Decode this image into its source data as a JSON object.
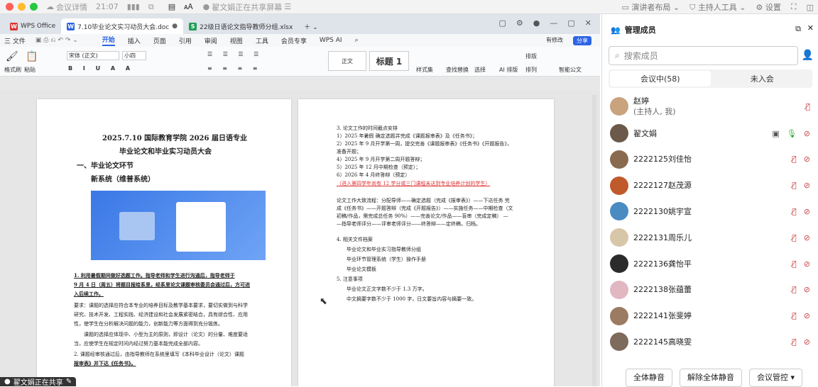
{
  "topbar": {
    "meeting_details": "会议详情",
    "time": "21:07",
    "sharing": "翟文娟正在共享屏幕",
    "presenter_layout": "演讲者布局",
    "host_tools": "主持人工具",
    "settings": "设置"
  },
  "wps": {
    "tabs": [
      "WPS Office",
      "7.10毕业论文实习动员大会.doc",
      "22级日语论文指导教师分组.xlsx"
    ],
    "menus": [
      "三 文件",
      "开始",
      "插入",
      "页面",
      "引用",
      "审阅",
      "视图",
      "工具",
      "会员专享",
      "WPS AI"
    ],
    "edit_label": "有修改",
    "share_label": "分享",
    "ribbon": {
      "format_painter": "格式刷",
      "paste": "粘贴",
      "font": "宋体 (正文)",
      "size": "小四",
      "style_normal": "正文",
      "style_heading": "标题 1",
      "style_set": "样式集",
      "find_replace": "查找替换",
      "select": "选择",
      "ai_layout": "AI 排版",
      "arrange": "排版",
      "sort": "排列",
      "smart_doc": "智能公文"
    }
  },
  "page1": {
    "title1": "2025.7.10 国际教育学院 2026 届日语专业",
    "title2": "毕业论文和毕业实习动员大会",
    "h1": "一、毕业论文环节",
    "h2": "新系统（维普系统）",
    "l1": "1. 利用暑假期间做好选题工作。指导老师和学生进行沟通后，指导老师于",
    "l2": "9 月 4 日（周五）将题目报给系里，经系里论文课题审核委员会通过后，方可进",
    "l3": "入后续工作。",
    "l4": "要求：课题的选择应符合本专业的培养目标及教学基本要求，要切实做到与科学",
    "l5": "研究、技术开发、工程实践、经济建设和社会发展紧密结合，具有综合性、应用",
    "l6": "性，使学生在分析解决问题的能力，创新能力等方面得到充分锻炼。",
    "l7": "课题的选择应体现中、小型为主的原则，即设计（论文）的分量、难度要适",
    "l8": "当，应使学生在规定时间内经过努力基本能完成全部内容。",
    "l9": "2. 课题经审核通过后，由指导教师在系统里填写《本科毕业设计（论文）课题",
    "l10": "报审表》并下达《任务书》。"
  },
  "page2": {
    "p1": "3. 论文工作的时间截点安排",
    "p2": "1）2025 年暑假 确定选题并完成《课题报审表》及《任务书》；",
    "p3": "2）2025 年 9 月开学第一周，提交完善《课题报审表》《任务书》《开题报告》，",
    "p4": "准备开题；",
    "p5": "4）2025 年 9 月开学第二周开题答辩；",
    "p6": "5）2025 年 12 月中期检查（预定）；",
    "p7": "6）2026 年 4 月终答辩（预定）",
    "p8": "（进入第四学年尚有 12 学分或三门课程未达到专业培养计划的学生）",
    "p9": "论文工作大致流程：分配导师——确定选题（完成《报审表》）——下达任务 完",
    "p10": "成《任务书》——开题答辩（完成《开题报告》）——实施任务——中期检查（文",
    "p11": "初稿/作品，需完成总任务 90%）——完善论文/作品——盲审（完成定稿） —",
    "p12": "—指导老师评分——评审老师评分——终答辩——定终稿，归档。",
    "p13": "4.   相关文件档案",
    "p14": "毕业论文和毕业实习指导教师分组",
    "p15": "毕业环节管理系统（学生）操作手册",
    "p16": "毕业论文模板",
    "p17": "5.   注意事项",
    "p18": "毕业论文正文字数不少于 1.3 万字。",
    "p19": "中文摘要字数不少于 1000 字，日文要旨内容与摘要一致。"
  },
  "panel": {
    "title": "管理成员",
    "search_placeholder": "搜索成员",
    "seg_in": "会议中(58)",
    "seg_out": "未入会",
    "members": [
      {
        "name": "赵婷",
        "sub": "(主持人, 我)",
        "color": "#c9a27e"
      },
      {
        "name": "翟文娟",
        "sub": "",
        "color": "#6b5a4a"
      },
      {
        "name": "2222125刘佳怡",
        "sub": "",
        "color": "#8a6a4f"
      },
      {
        "name": "2222127赵茂源",
        "sub": "",
        "color": "#c05a2b"
      },
      {
        "name": "2222130姚宇宣",
        "sub": "",
        "color": "#4a8bc2"
      },
      {
        "name": "2222131周乐儿",
        "sub": "",
        "color": "#d8c6a8"
      },
      {
        "name": "2222136龚怡平",
        "sub": "",
        "color": "#2b2b2b"
      },
      {
        "name": "2222138张蕴蕾",
        "sub": "",
        "color": "#e1b7c2"
      },
      {
        "name": "2222141张斐婷",
        "sub": "",
        "color": "#9c7b63"
      },
      {
        "name": "2222145高晓雯",
        "sub": "",
        "color": "#7d6b5c"
      }
    ],
    "mute_all": "全体静音",
    "unmute_all": "解除全体静音",
    "meeting_control": "会议管控"
  },
  "share_indicator": "翟文娟正在共享"
}
